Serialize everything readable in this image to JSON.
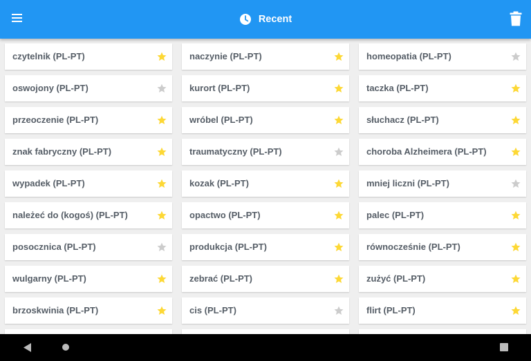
{
  "app_bar": {
    "title": "Recent",
    "menu_icon": "hamburger-menu-icon",
    "title_icon": "clock-icon",
    "action_icon": "trash-icon",
    "color": "#2196f3"
  },
  "colors": {
    "star_on": "#fdd835",
    "star_off": "#cccccc"
  },
  "cards": [
    {
      "label": "czytelnik (PL-PT)",
      "starred": true
    },
    {
      "label": "naczynie (PL-PT)",
      "starred": true
    },
    {
      "label": "homeopatia (PL-PT)",
      "starred": false
    },
    {
      "label": "oswojony (PL-PT)",
      "starred": false
    },
    {
      "label": "kurort (PL-PT)",
      "starred": true
    },
    {
      "label": "taczka (PL-PT)",
      "starred": true
    },
    {
      "label": "przeoczenie (PL-PT)",
      "starred": true
    },
    {
      "label": "wróbel (PL-PT)",
      "starred": true
    },
    {
      "label": "słuchacz (PL-PT)",
      "starred": true
    },
    {
      "label": "znak fabryczny (PL-PT)",
      "starred": true
    },
    {
      "label": "traumatyczny (PL-PT)",
      "starred": false
    },
    {
      "label": "choroba Alzheimera (PL-PT)",
      "starred": true
    },
    {
      "label": "wypadek (PL-PT)",
      "starred": true
    },
    {
      "label": "kozak (PL-PT)",
      "starred": true
    },
    {
      "label": "mniej liczni (PL-PT)",
      "starred": false
    },
    {
      "label": "należeć do (kogoś) (PL-PT)",
      "starred": true
    },
    {
      "label": "opactwo (PL-PT)",
      "starred": true
    },
    {
      "label": "palec (PL-PT)",
      "starred": true
    },
    {
      "label": "posocznica (PL-PT)",
      "starred": false
    },
    {
      "label": "produkcja (PL-PT)",
      "starred": true
    },
    {
      "label": "równocześnie (PL-PT)",
      "starred": true
    },
    {
      "label": "wulgarny (PL-PT)",
      "starred": true
    },
    {
      "label": "zebrać (PL-PT)",
      "starred": true
    },
    {
      "label": "zużyć (PL-PT)",
      "starred": true
    },
    {
      "label": "brzoskwinia (PL-PT)",
      "starred": true
    },
    {
      "label": "cis (PL-PT)",
      "starred": false
    },
    {
      "label": "flirt (PL-PT)",
      "starred": true
    }
  ],
  "nav_bar": {
    "back_icon": "back-triangle-icon",
    "home_icon": "home-circle-icon",
    "recents_icon": "recents-square-icon"
  }
}
